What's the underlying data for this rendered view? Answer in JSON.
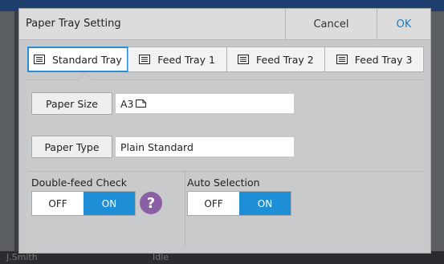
{
  "background": {
    "user": "J.Smith",
    "status": "Idle"
  },
  "dialog": {
    "title": "Paper Tray Setting",
    "cancel_label": "Cancel",
    "ok_label": "OK"
  },
  "tabs": [
    {
      "label": "Standard Tray",
      "icon": "tray-icon",
      "active": true
    },
    {
      "label": "Feed Tray 1",
      "icon": "tray-icon",
      "active": false
    },
    {
      "label": "Feed Tray 2",
      "icon": "tray-icon",
      "active": false
    },
    {
      "label": "Feed Tray 3",
      "icon": "tray-icon",
      "active": false
    }
  ],
  "paper_size": {
    "button_label": "Paper Size",
    "value": "A3"
  },
  "paper_type": {
    "button_label": "Paper Type",
    "value": "Plain Standard"
  },
  "double_feed_check": {
    "label": "Double-feed Check",
    "off_label": "OFF",
    "on_label": "ON",
    "selected": "ON",
    "help_label": "?"
  },
  "auto_selection": {
    "label": "Auto Selection",
    "off_label": "OFF",
    "on_label": "ON",
    "selected": "ON"
  },
  "colors": {
    "accent": "#1e8fd6",
    "ok_text": "#1a7ac7",
    "help": "#8a5fa6"
  }
}
